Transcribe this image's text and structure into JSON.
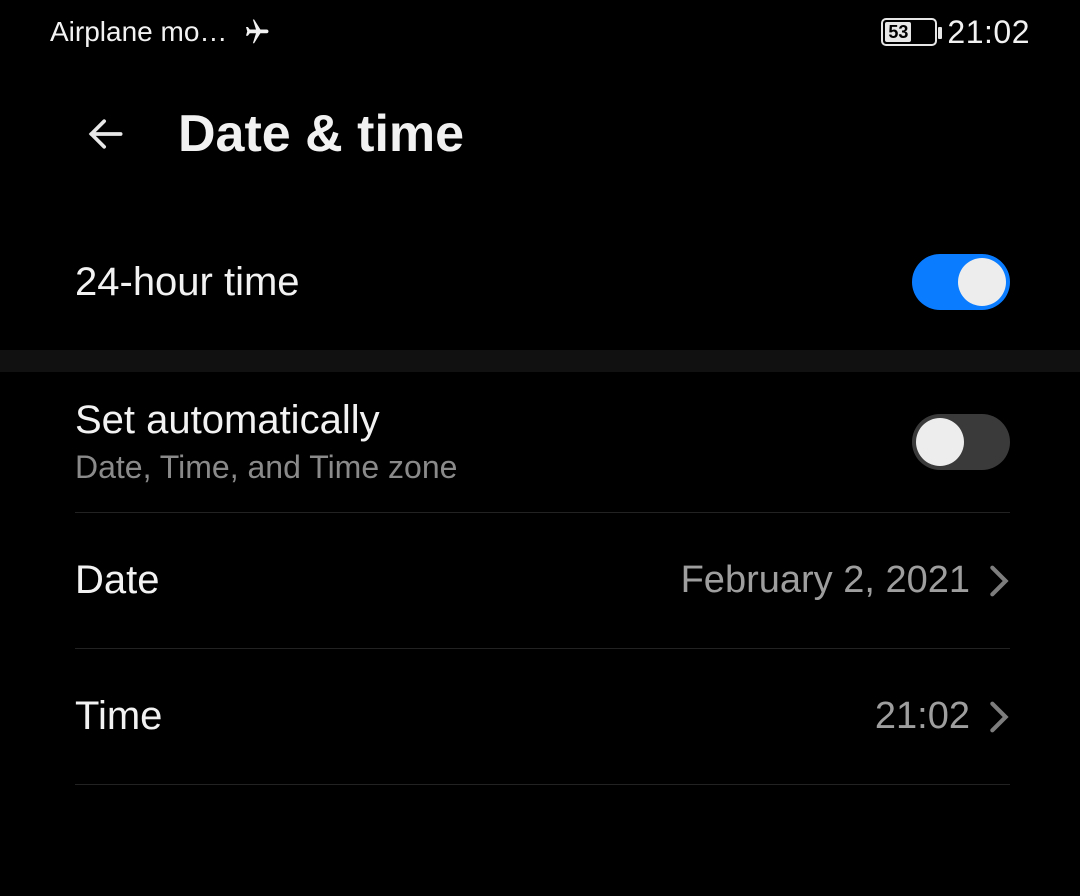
{
  "status_bar": {
    "airplane_label": "Airplane mo…",
    "battery_percent": "53",
    "clock": "21:02"
  },
  "header": {
    "title": "Date & time"
  },
  "rows": {
    "twenty_four": {
      "label": "24-hour time",
      "toggle_on": true
    },
    "set_auto": {
      "label": "Set automatically",
      "subtitle": "Date, Time, and Time zone",
      "toggle_on": false
    },
    "date": {
      "label": "Date",
      "value": "February 2, 2021"
    },
    "time": {
      "label": "Time",
      "value": "21:02"
    }
  }
}
